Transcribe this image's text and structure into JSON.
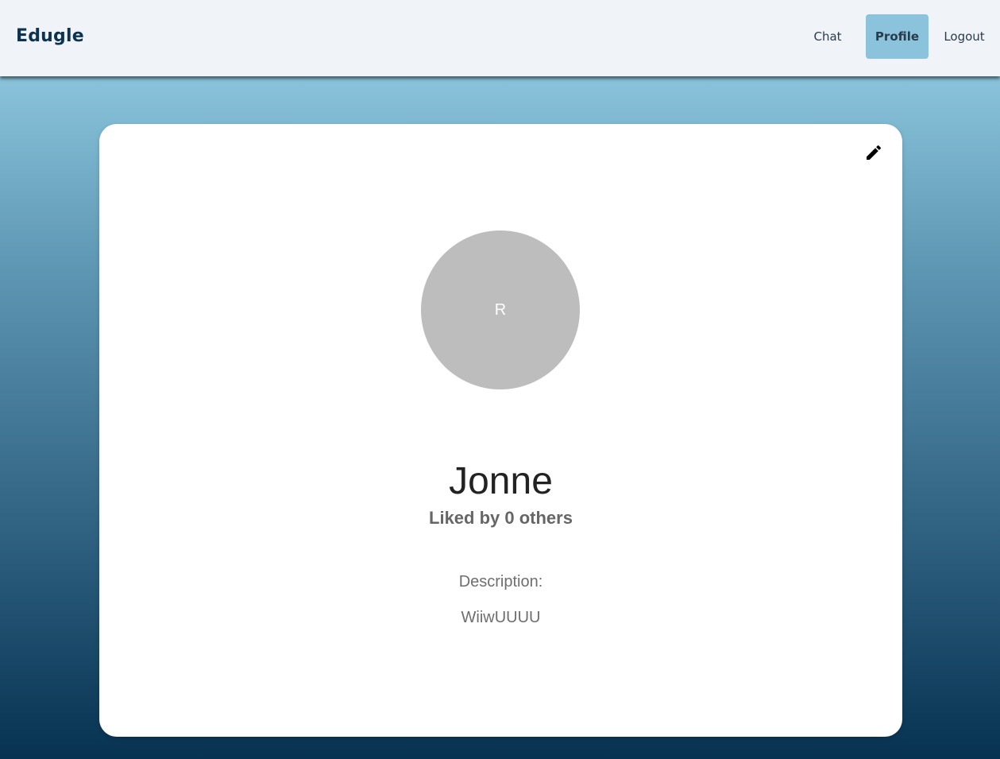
{
  "navbar": {
    "brand": "Edugle",
    "links": [
      {
        "label": "Chat",
        "active": false
      },
      {
        "label": "Profile",
        "active": true
      },
      {
        "label": "Logout",
        "active": false
      }
    ]
  },
  "profile": {
    "avatar_initial": "R",
    "name": "Jonne",
    "likes_text": "Liked by 0 others",
    "description_label": "Description:",
    "description": "WiiwUUUU",
    "edit_icon": "pencil-icon"
  },
  "colors": {
    "navbar_bg": "#f0f4f8",
    "brand": "#0d3350",
    "active_link_bg": "#8ac3db",
    "avatar_bg": "#bdbdbd",
    "gradient_top": "#8ac3db",
    "gradient_bottom": "#073251"
  }
}
